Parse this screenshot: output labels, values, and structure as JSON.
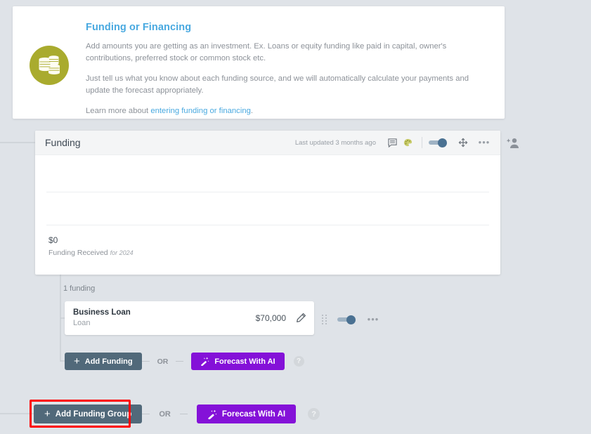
{
  "info_card": {
    "icon": "coins-icon",
    "title": "Funding or Financing",
    "paragraph1": "Add amounts you are getting as an investment. Ex. Loans or equity funding like paid in capital, owner's contributions, preferred stock or common stock etc.",
    "paragraph2": "Just tell us what you know about each funding source, and we will automatically calculate your payments and update the forecast appropriately.",
    "learn_prefix": "Learn more about ",
    "learn_link": "entering funding or financing",
    "learn_suffix": ".",
    "title_color": "#49a9e0",
    "icon_color": "#a9ab2e"
  },
  "panel": {
    "title": "Funding",
    "last_updated": "Last updated 3 months ago",
    "icons": {
      "comment": "comment-icon",
      "palette": "palette-icon",
      "toggle": "visibility-toggle",
      "move": "move-icon",
      "more": "more-options-icon",
      "add_person": "add-person-icon"
    },
    "chart": {
      "value": "$0",
      "label": "Funding Received",
      "label_period": "for 2024"
    }
  },
  "funding_group": {
    "count_label": "1 funding",
    "item": {
      "name": "Business Loan",
      "type": "Loan",
      "amount": "$70,000",
      "edit_icon": "pencil-icon",
      "grip_icon": "drag-handle-icon",
      "toggle_icon": "enabled-toggle",
      "more_icon": "more-options-icon"
    },
    "actions": {
      "add_label": "Add Funding",
      "or_label": "OR",
      "forecast_label": "Forecast With AI",
      "help_label": "?"
    }
  },
  "group_actions": {
    "add_group_label": "Add Funding Group",
    "or_label": "OR",
    "forecast_label": "Forecast With AI",
    "help_label": "?"
  },
  "colors": {
    "background": "#dfe3e8",
    "slate_button": "#51697a",
    "purple_button": "#8411d8",
    "highlight_red": "#ff0000",
    "link_blue": "#49a9e0"
  }
}
